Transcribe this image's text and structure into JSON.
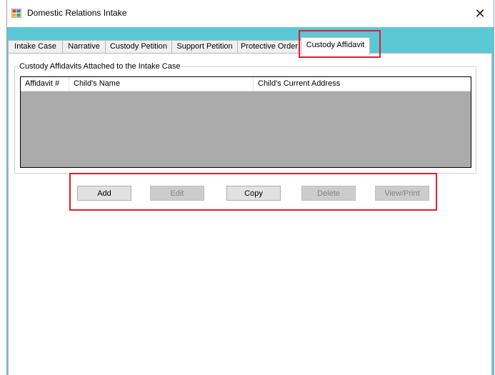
{
  "window": {
    "title": "Domestic Relations Intake",
    "close_glyph": "✕",
    "background_accent": "#5bc8d6"
  },
  "tabs": [
    {
      "label": "Intake Case",
      "active": false
    },
    {
      "label": "Narrative",
      "active": false
    },
    {
      "label": "Custody Petition",
      "active": false
    },
    {
      "label": "Support Petition",
      "active": false
    },
    {
      "label": "Protective Order",
      "active": false
    },
    {
      "label": "Custody Affidavit",
      "active": true
    }
  ],
  "group": {
    "title": "Custody Affidavits Attached to the Intake Case",
    "columns": [
      "Affidavit #",
      "Child's Name",
      "Child's Current Address"
    ],
    "rows": []
  },
  "buttons": [
    {
      "label": "Add",
      "enabled": true
    },
    {
      "label": "Edit",
      "enabled": false
    },
    {
      "label": "Copy",
      "enabled": true
    },
    {
      "label": "Delete",
      "enabled": false
    },
    {
      "label": "View/Print",
      "enabled": false
    }
  ],
  "highlight_color": "#e21d2a"
}
